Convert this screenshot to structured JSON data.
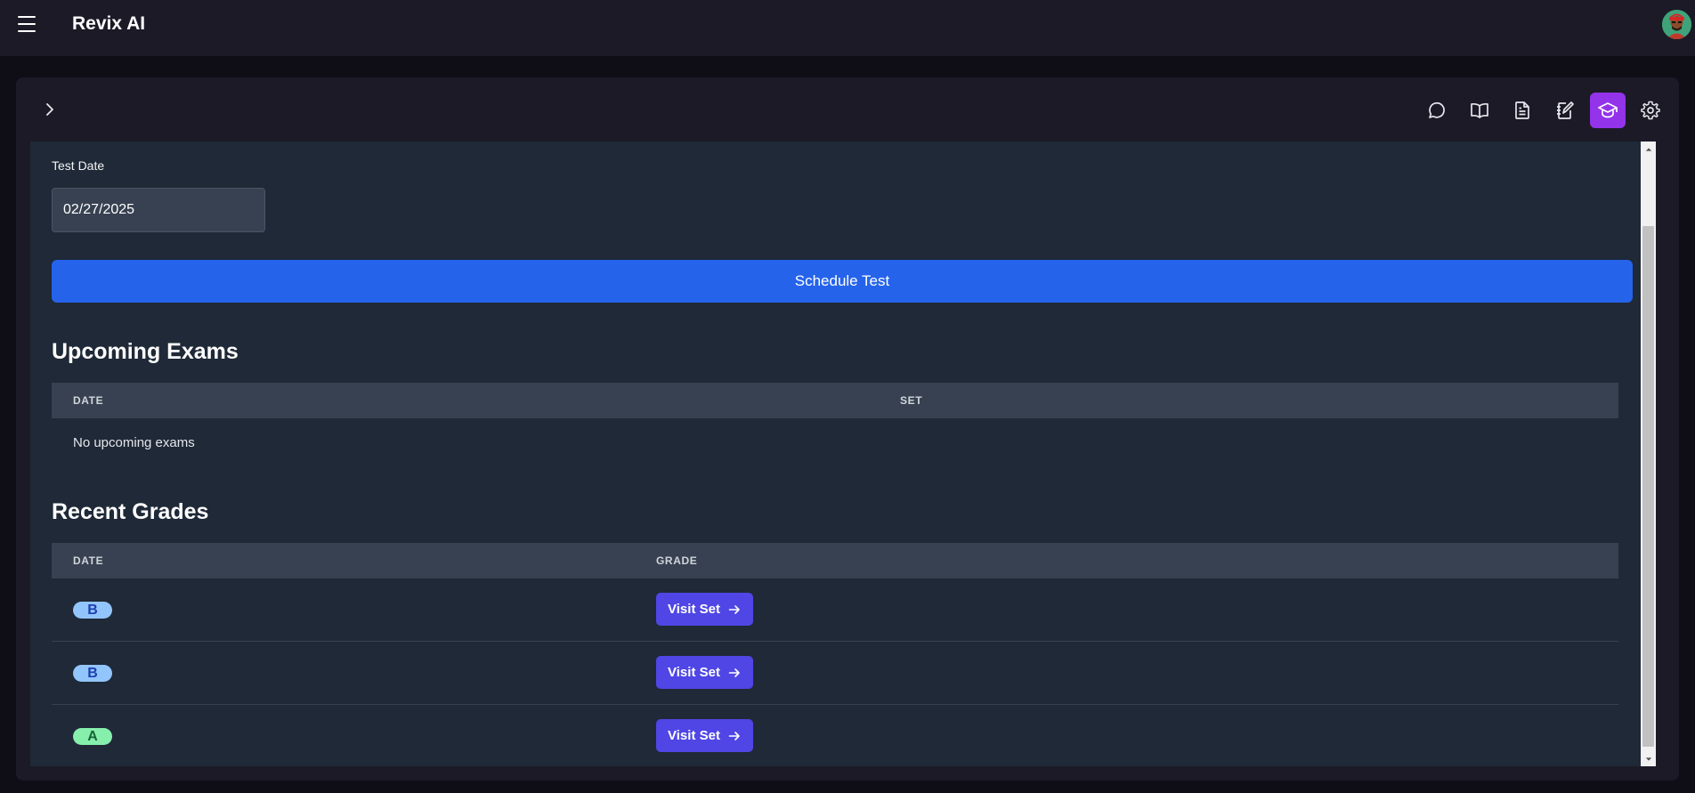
{
  "app": {
    "title": "Revix AI"
  },
  "toolbar": {
    "icons": [
      "chat-icon",
      "book-open-icon",
      "document-icon",
      "notebook-icon",
      "graduation-cap-icon",
      "gear-icon"
    ],
    "active": "graduation-cap-icon",
    "active_color": "#9333ea"
  },
  "form": {
    "test_date_label": "Test Date",
    "test_date_value": "02/27/2025",
    "schedule_button": "Schedule Test"
  },
  "upcoming": {
    "title": "Upcoming Exams",
    "columns": [
      "DATE",
      "SET"
    ],
    "empty_text": "No upcoming exams"
  },
  "recent": {
    "title": "Recent Grades",
    "columns": [
      "DATE",
      "GRADE"
    ],
    "rows": [
      {
        "grade": "B",
        "badge_bg": "#93c5fd",
        "badge_fg": "#1e40af",
        "button": "Visit Set"
      },
      {
        "grade": "B",
        "badge_bg": "#93c5fd",
        "badge_fg": "#1e40af",
        "button": "Visit Set"
      },
      {
        "grade": "A",
        "badge_bg": "#86efac",
        "badge_fg": "#166534",
        "button": "Visit Set"
      }
    ]
  },
  "colors": {
    "primary": "#2563eb",
    "visit_button": "#4f46e5",
    "content_bg": "#1f2937"
  }
}
